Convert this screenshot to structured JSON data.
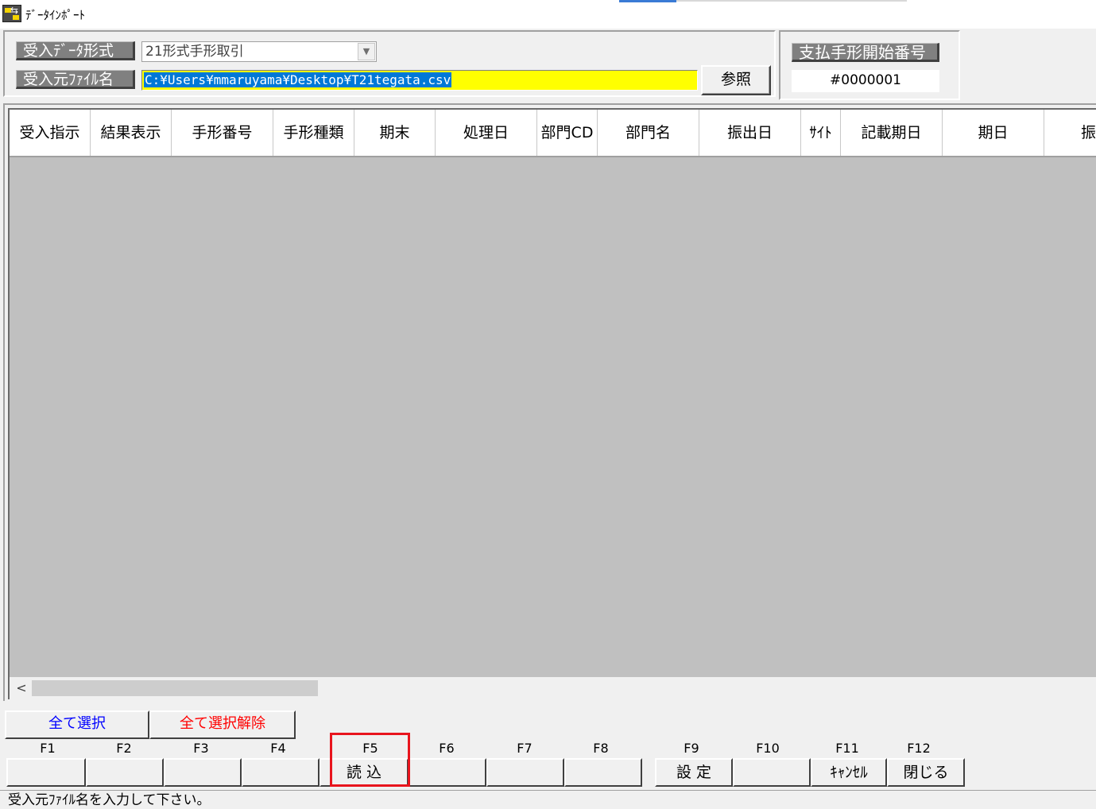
{
  "window": {
    "title": "ﾃﾞｰﾀｲﾝﾎﾟｰﾄ"
  },
  "form": {
    "format_label": "受入ﾃﾞｰﾀ形式",
    "format_value": "21形式手形取引",
    "file_label": "受入元ﾌｧｲﾙ名",
    "file_value": "C:¥Users¥mmaruyama¥Desktop¥T21tegata.csv",
    "browse_label": "参照",
    "start_label": "支払手形開始番号",
    "start_value": "#0000001"
  },
  "grid": {
    "columns": [
      "受入指示",
      "結果表示",
      "手形番号",
      "手形種類",
      "期末",
      "処理日",
      "部門CD",
      "部門名",
      "振出日",
      "ｻｲﾄ",
      "記載期日",
      "期日",
      "振"
    ]
  },
  "select": {
    "all_label": "全て選択",
    "all_color": "#0000ff",
    "none_label": "全て選択解除",
    "none_color": "#ff0000"
  },
  "fkeys": [
    {
      "key": "F1",
      "label": ""
    },
    {
      "key": "F2",
      "label": ""
    },
    {
      "key": "F3",
      "label": ""
    },
    {
      "key": "F4",
      "label": ""
    },
    {
      "key": "F5",
      "label": "読 込"
    },
    {
      "key": "F6",
      "label": ""
    },
    {
      "key": "F7",
      "label": ""
    },
    {
      "key": "F8",
      "label": ""
    },
    {
      "key": "F9",
      "label": "設 定"
    },
    {
      "key": "F10",
      "label": ""
    },
    {
      "key": "F11",
      "label": "ｷｬﾝｾﾙ"
    },
    {
      "key": "F12",
      "label": "閉じる"
    }
  ],
  "status": {
    "message": "受入元ﾌｧｲﾙ名を入力して下さい。"
  },
  "colors": {
    "file_input_bg": "#ffff00",
    "highlight": "#e8141d",
    "grid_bg": "#c0c0c0"
  }
}
